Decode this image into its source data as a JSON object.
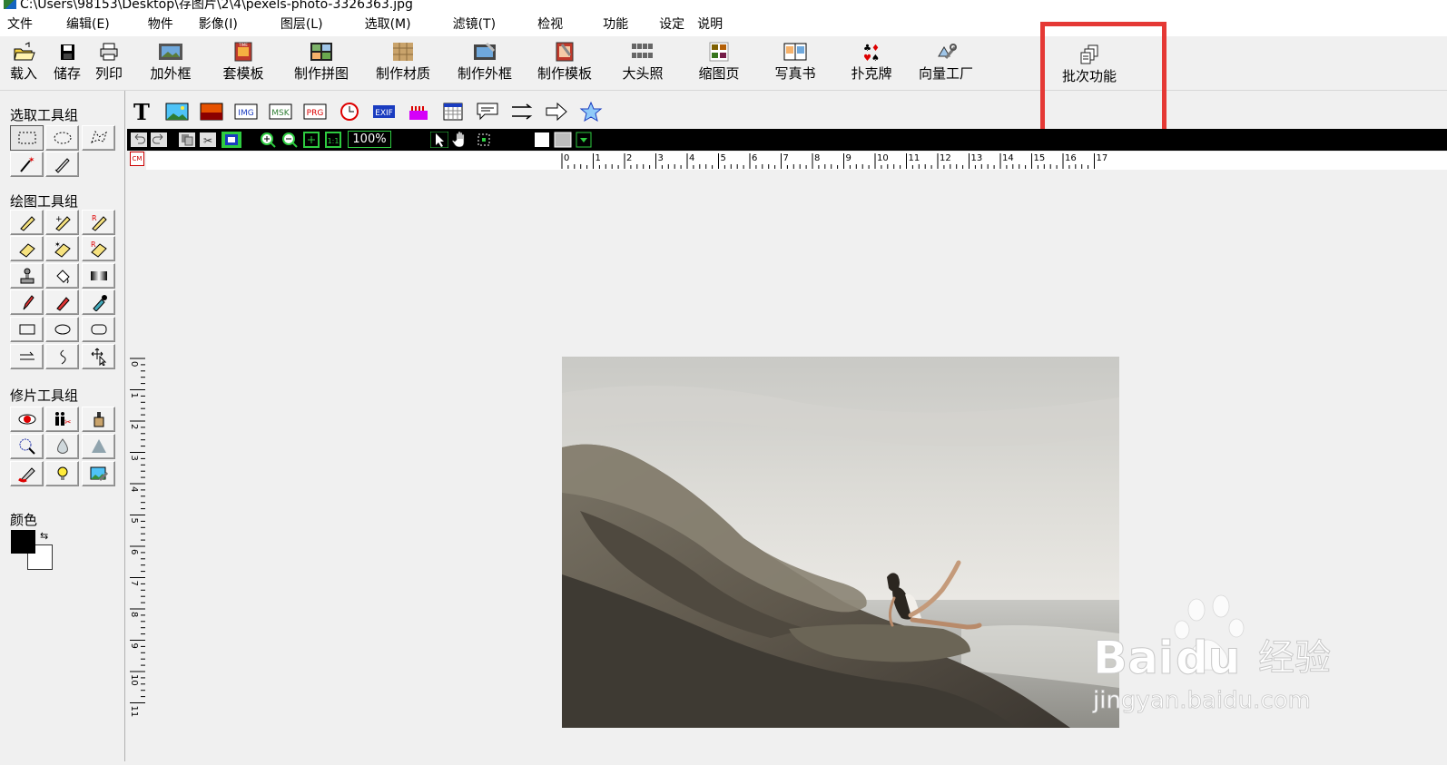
{
  "window": {
    "title": "C:\\Users\\98153\\Desktop\\存图片\\2\\4\\pexels-photo-3326363.jpg"
  },
  "menu": [
    {
      "label": "文件"
    },
    {
      "label": "编辑(E)"
    },
    {
      "label": "物件"
    },
    {
      "label": "影像(I)"
    },
    {
      "label": "图层(L)"
    },
    {
      "label": "选取(M)"
    },
    {
      "label": "滤镜(T)"
    },
    {
      "label": "检视"
    },
    {
      "label": "功能"
    },
    {
      "label": "设定"
    },
    {
      "label": "说明"
    }
  ],
  "toolbar": {
    "load": "载入",
    "save": "储存",
    "print": "列印",
    "add_frame": "加外框",
    "apply_template": "套模板",
    "make_collage": "制作拼图",
    "make_material": "制作材质",
    "make_frame": "制作外框",
    "make_template": "制作模板",
    "id_photo": "大头照",
    "thumbnail_page": "缩图页",
    "photo_book": "写真书",
    "poker": "扑克牌",
    "vector_factory": "向量工厂",
    "batch": "批次功能"
  },
  "panels": {
    "select_group": "选取工具组",
    "draw_group": "绘图工具组",
    "retouch_group": "修片工具组",
    "color": "颜色"
  },
  "colors": {
    "foreground": "#000000",
    "background": "#ffffff",
    "highlight": "#e53935"
  },
  "zoom": "100%",
  "ruler_unit": "CM",
  "ruler_h_labels": [
    "0",
    "1",
    "2",
    "3",
    "4",
    "5",
    "6",
    "7",
    "8",
    "9",
    "10",
    "11",
    "12",
    "13",
    "14",
    "15",
    "16",
    "17"
  ],
  "ruler_v_labels": [
    "0",
    "1",
    "2",
    "3",
    "4",
    "5",
    "6",
    "7",
    "8",
    "9",
    "10",
    "11"
  ],
  "watermark": {
    "brand": "Bai",
    "brand2": "du",
    "cn": "经验",
    "url": "jingyan.baidu.com"
  }
}
